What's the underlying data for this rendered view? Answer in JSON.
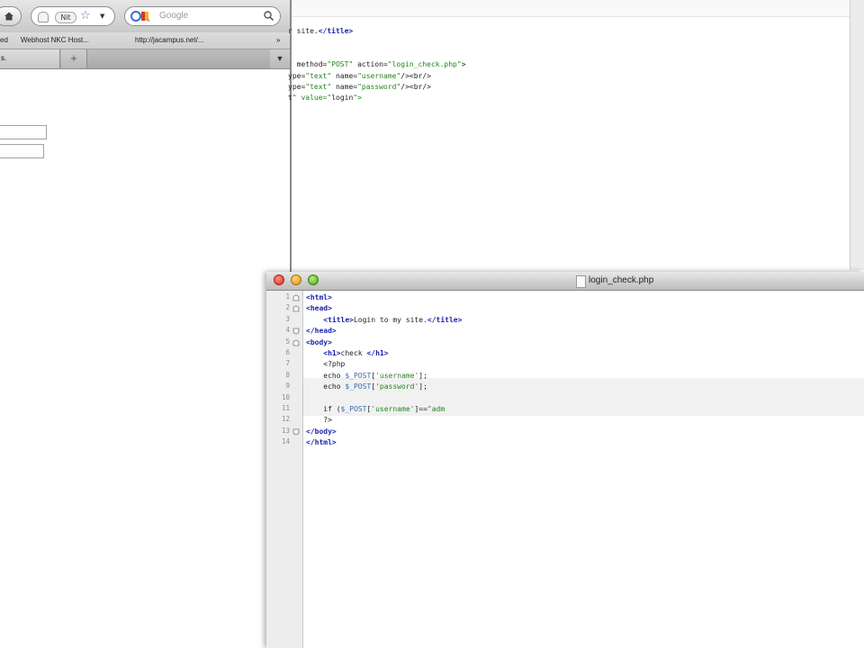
{
  "browser": {
    "search_placeholder": "Google",
    "address_short": "Nit",
    "bookmarks": [
      "ed",
      "Webhost NKC Host...",
      "http://jacampus.net/...",
      "»"
    ],
    "tab_label": "s.",
    "new_tab_symbol": "+",
    "tab_list_symbol": "▼"
  },
  "back_editor": {
    "lines": [
      "r site.</title>",
      "",
      "",
      "  method=\"POST\" action=\"login_check.php\">",
      "ype=\"text\" name=\"username\"/><br/>",
      "ype=\"text\" name=\"password\"/><br/>",
      "t\" value=\"login\">"
    ]
  },
  "front_editor": {
    "title": "login_check.php",
    "line_numbers": [
      "1",
      "2",
      "3",
      "4",
      "5",
      "6",
      "7",
      "8",
      "9",
      "10",
      "11",
      "12",
      "13",
      "14"
    ],
    "lines": [
      "<html>",
      "<head>",
      "    <title>Login to my site.</title>",
      "</head>",
      "<body>",
      "    <h1>check </h1>",
      "    <?php",
      "    echo $_POST['username'];",
      "    echo $_POST['password'];",
      "",
      "    if ($_POST['username']==\"adm",
      "    ?>",
      "</body>",
      "</html>"
    ]
  }
}
